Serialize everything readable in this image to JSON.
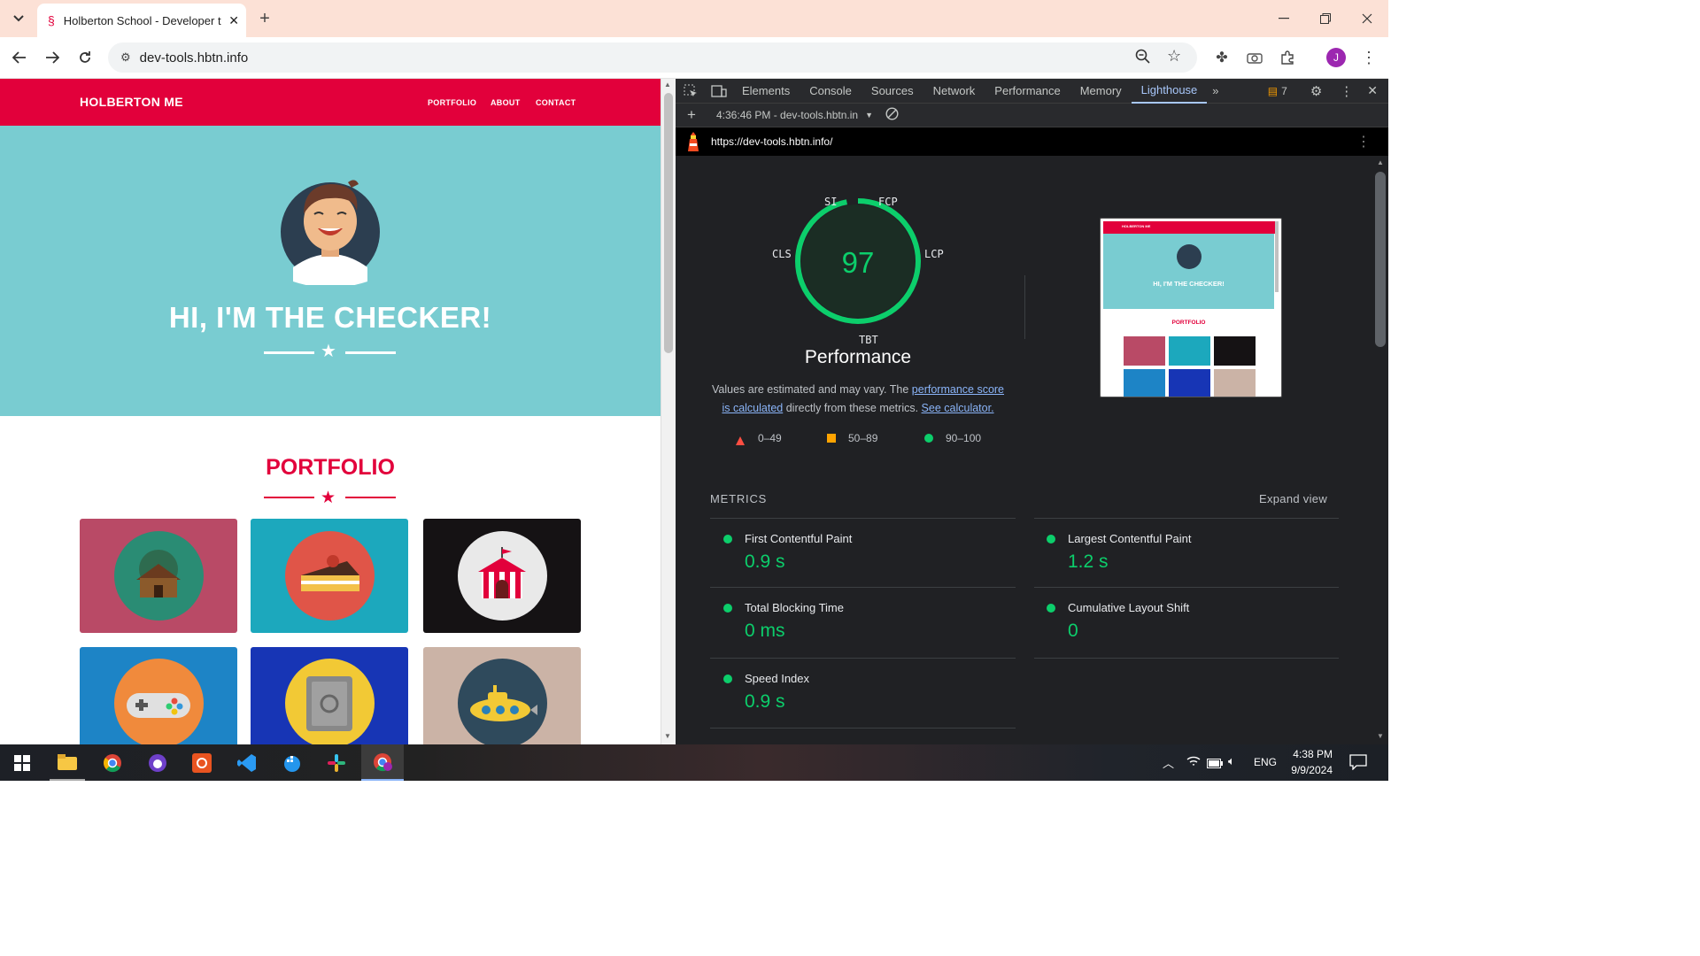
{
  "browser": {
    "tab_title": "Holberton School - Developer t",
    "url": "dev-tools.hbtn.info"
  },
  "site": {
    "brand": "HOLBERTON ME",
    "nav": [
      "PORTFOLIO",
      "ABOUT",
      "CONTACT"
    ],
    "hero_title": "HI, I'M THE CHECKER!",
    "portfolio_title": "PORTFOLIO",
    "tile_colors": [
      "#b94a66",
      "#1ca8bd",
      "#151214",
      "#1d84c6",
      "#1735b5",
      "#cbb3a6"
    ]
  },
  "devtools": {
    "tabs": [
      "Elements",
      "Console",
      "Sources",
      "Network",
      "Performance",
      "Memory",
      "Lighthouse"
    ],
    "active_tab": "Lighthouse",
    "issues_count": "7",
    "report_select": "4:36:46 PM - dev-tools.hbtn.in",
    "report_url": "https://dev-tools.hbtn.info/",
    "score": "97",
    "gauge_labels": {
      "si": "SI",
      "fcp": "FCP",
      "lcp": "LCP",
      "tbt": "TBT",
      "cls": "CLS"
    },
    "category": "Performance",
    "desc_prefix": "Values are estimated and may vary. The ",
    "desc_link1": "performance score is calculated",
    "desc_mid": " directly from these metrics. ",
    "desc_link2": "See calculator.",
    "legend": [
      "0–49",
      "50–89",
      "90–100"
    ],
    "metrics_heading": "METRICS",
    "expand_view": "Expand view",
    "metrics": [
      {
        "name": "First Contentful Paint",
        "value": "0.9 s"
      },
      {
        "name": "Largest Contentful Paint",
        "value": "1.2 s"
      },
      {
        "name": "Total Blocking Time",
        "value": "0 ms"
      },
      {
        "name": "Cumulative Layout Shift",
        "value": "0"
      },
      {
        "name": "Speed Index",
        "value": "0.9 s"
      }
    ],
    "thumb": {
      "brand": "HOLBERTON ME",
      "hero": "HI, I'M THE CHECKER!",
      "portfolio": "PORTFOLIO"
    },
    "colors": {
      "pass": "#0cce6b",
      "fail": "#ff4e42",
      "average": "#ffa400",
      "link": "#8ab4f8"
    }
  },
  "taskbar": {
    "lang": "ENG",
    "time": "4:38 PM",
    "date": "9/9/2024"
  }
}
